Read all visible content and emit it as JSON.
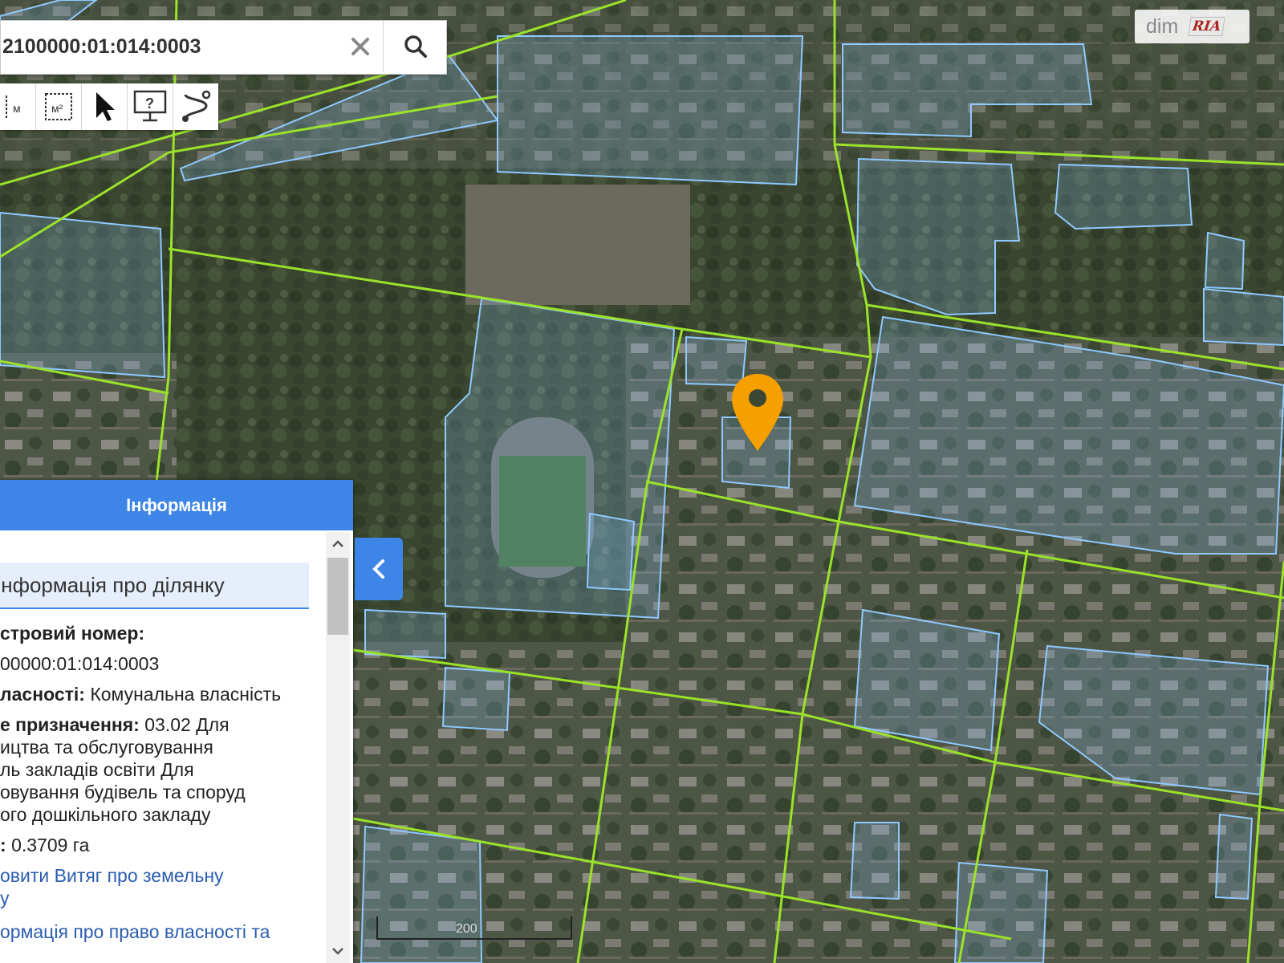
{
  "search": {
    "value": "2100000:01:014:0003",
    "placeholder": ""
  },
  "toolbar": {
    "items": [
      {
        "name": "measure-distance",
        "label": "м"
      },
      {
        "name": "measure-area",
        "label": "м²"
      },
      {
        "name": "select",
        "label": ""
      },
      {
        "name": "identify-help",
        "label": "?"
      },
      {
        "name": "route",
        "label": ""
      }
    ]
  },
  "watermark": {
    "brand": "dim",
    "logo": "RIA"
  },
  "info_panel": {
    "header": "Інформація",
    "section_title": "Інформація про ділянку",
    "cadastral_label": "стровий номер:",
    "cadastral_value": "00000:01:014:0003",
    "ownership_label": "ласності:",
    "ownership_value": "Комунальна власність",
    "purpose_label": "е призначення:",
    "purpose_line1": "03.02 Для",
    "purpose_line2": "ицтва та обслуговування",
    "purpose_line3": "ль закладів освіти Для",
    "purpose_line4": "овування будівель та споруд",
    "purpose_line5": "ого дошкільного закладу",
    "area_label": ":",
    "area_value": "0.3709 га",
    "link1_line1": "овити Витяг про земельну",
    "link1_line2": "у",
    "link2": "ормація про право власності та"
  },
  "scale": {
    "label": "200"
  },
  "colors": {
    "panel_blue": "#3d85e6",
    "parcel_blue": "#8fc9ff",
    "boundary_green": "#9be22a",
    "marker_orange": "#f5a000"
  }
}
